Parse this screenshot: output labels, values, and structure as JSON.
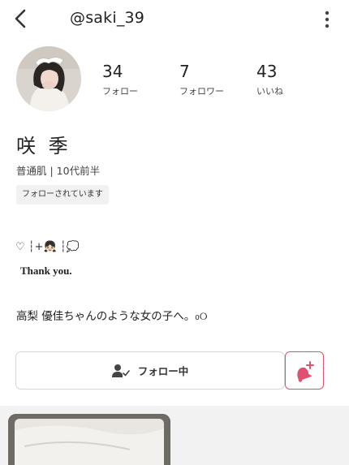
{
  "header": {
    "username": "@saki_39",
    "back_icon": "chevron-left-icon",
    "menu_icon": "more-vertical-icon"
  },
  "profile": {
    "display_name": "咲 季",
    "skin_info": "普通肌 | 10代前半",
    "follows_you_badge": "フォローされています"
  },
  "stats": [
    {
      "value": "34",
      "label": "フォロー"
    },
    {
      "value": "7",
      "label": "フォロワー"
    },
    {
      "value": "43",
      "label": "いいね"
    }
  ],
  "bio": {
    "line1": "♡ ┆+👧🏻 ┆💭",
    "line2": "Thank you.",
    "line3": "高梨 優佳ちゃんのような女の子へ。₀୦"
  },
  "actions": {
    "follow_label": "フォロー中",
    "follow_icon": "user-check-icon",
    "notify_icon": "bell-plus-icon"
  },
  "colors": {
    "accent": "#e0506f",
    "gallery_background": "#f2f2f2"
  }
}
